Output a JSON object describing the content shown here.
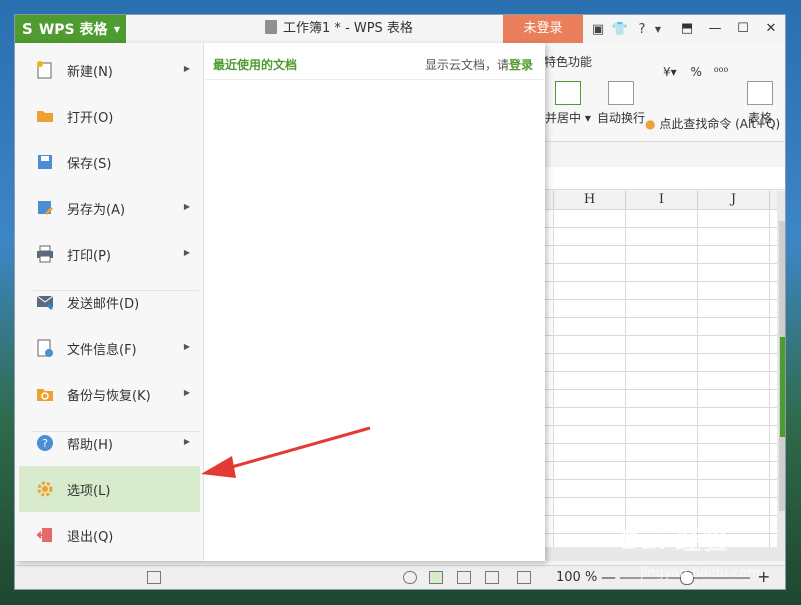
{
  "app": {
    "logo": "S",
    "name": "WPS 表格"
  },
  "document": {
    "title": "工作簿1 * - WPS 表格"
  },
  "titlebar": {
    "login_label": "未登录"
  },
  "ribbon": {
    "tab_label": "特色功能",
    "center_label": "并居中",
    "wrap_label": "自动换行",
    "table_label": "表格",
    "percent": "%",
    "search_command": "点此查找命令 (Alt+Q)"
  },
  "sheet": {
    "columns": [
      "H",
      "I",
      "J"
    ]
  },
  "menu": {
    "items": [
      {
        "label": "新建(N)",
        "submenu": true
      },
      {
        "label": "打开(O)",
        "submenu": false
      },
      {
        "label": "保存(S)",
        "submenu": false
      },
      {
        "label": "另存为(A)",
        "submenu": true
      },
      {
        "label": "打印(P)",
        "submenu": true
      },
      {
        "label": "发送邮件(D)",
        "submenu": false
      },
      {
        "label": "文件信息(F)",
        "submenu": true
      },
      {
        "label": "备份与恢复(K)",
        "submenu": true
      },
      {
        "label": "帮助(H)",
        "submenu": true
      },
      {
        "label": "选项(L)",
        "submenu": false
      },
      {
        "label": "退出(Q)",
        "submenu": false
      }
    ],
    "recent_title": "最近使用的文档",
    "cloud_prefix": "显示云文档，请",
    "cloud_login": "登录"
  },
  "status": {
    "zoom": "100 %",
    "zoom_minus": "—",
    "zoom_plus": "+"
  },
  "watermark": {
    "main": "Bai 经验",
    "sub": "jingyan.baidu.com"
  },
  "colors": {
    "accent": "#4e9b2f",
    "login": "#e9805b",
    "active_item": "#d9ebcd",
    "annotation_arrow": "#e53935"
  }
}
